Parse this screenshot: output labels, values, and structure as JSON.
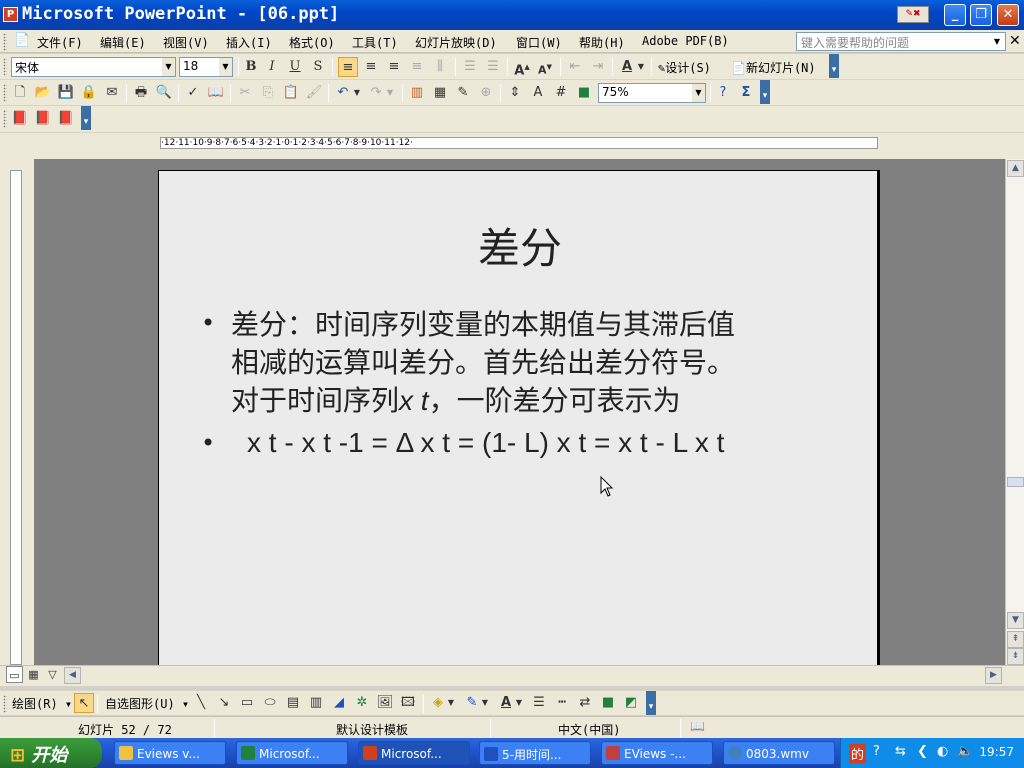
{
  "window": {
    "title": "Microsoft PowerPoint - [06.ppt]",
    "app_icon": "P"
  },
  "menu": {
    "items": [
      "文件(F)",
      "编辑(E)",
      "视图(V)",
      "插入(I)",
      "格式(O)",
      "工具(T)",
      "幻灯片放映(D)",
      "窗口(W)",
      "帮助(H)",
      "Adobe PDF(B)"
    ],
    "help_placeholder": "键入需要帮助的问题"
  },
  "format_toolbar": {
    "font": "宋体",
    "size": "18",
    "design_label": "设计(S)",
    "new_slide_label": "新幻灯片(N)"
  },
  "standard_toolbar": {
    "zoom": "75%"
  },
  "ruler": {
    "horizontal": "·12·11·10·9·8·7·6·5·4·3·2·1·0·1·2·3·4·5·6·7·8·9·10·11·12·"
  },
  "slide": {
    "title": "差分",
    "bullet1_line1": "差分：时间序列变量的本期值与其滞后值",
    "bullet1_line2": "相减的运算叫差分。首先给出差分符号。",
    "bullet1_line3_prefix": "对于时间序列",
    "bullet1_line3_var": "x t",
    "bullet1_line3_suffix": "，一阶差分可表示为",
    "formula": "x t - x t -1 = Δ x t = (1- L) x t = x t - L x t"
  },
  "drawing_toolbar": {
    "draw_label": "绘图(R)",
    "autoshapes_label": "自选图形(U)"
  },
  "status": {
    "slide_counter": "幻灯片 52 / 72",
    "template": "默认设计模板",
    "language": "中文(中国)"
  },
  "taskbar": {
    "start_label": "开始",
    "tasks": [
      "Eviews v...",
      "Microsof...",
      "Microsof...",
      "5-用时间...",
      "EViews -...",
      "0803.wmv"
    ],
    "clock": "19:57"
  },
  "colors": {
    "titlebar": "#0046c8",
    "chrome": "#ece9d8",
    "workspace": "#808080",
    "slide_bg": "#ebebeb",
    "taskbar": "#245edb",
    "start_button": "#2f8a2f"
  }
}
